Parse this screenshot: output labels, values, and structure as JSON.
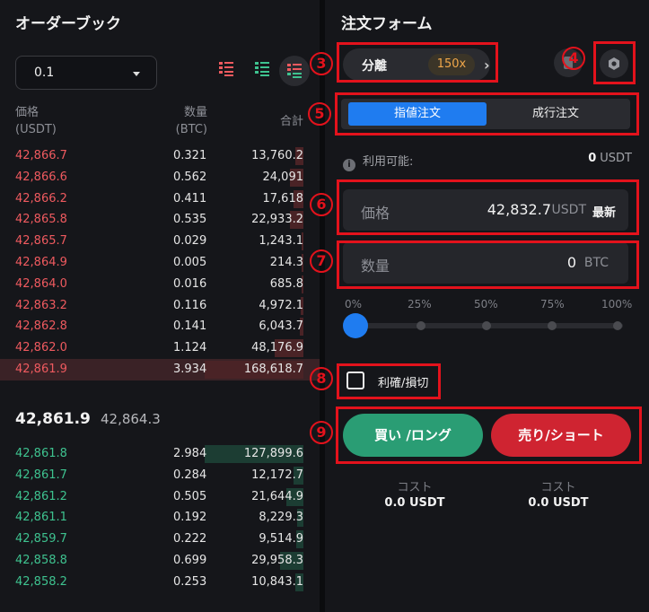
{
  "order_book": {
    "title": "オーダーブック",
    "precision": "0.1",
    "headers": {
      "price": "価格",
      "price_unit": "(USDT)",
      "qty": "数量",
      "qty_unit": "(BTC)",
      "total": "合計"
    },
    "asks": [
      {
        "price": "42,866.7",
        "qty": "0.321",
        "total": "13,760.2",
        "depth": 0.08
      },
      {
        "price": "42,866.6",
        "qty": "0.562",
        "total": "24,091",
        "depth": 0.14
      },
      {
        "price": "42,866.2",
        "qty": "0.411",
        "total": "17,618",
        "depth": 0.1
      },
      {
        "price": "42,865.8",
        "qty": "0.535",
        "total": "22,933.2",
        "depth": 0.14
      },
      {
        "price": "42,865.7",
        "qty": "0.029",
        "total": "1,243.1",
        "depth": 0.01
      },
      {
        "price": "42,864.9",
        "qty": "0.005",
        "total": "214.3",
        "depth": 0.005
      },
      {
        "price": "42,864.0",
        "qty": "0.016",
        "total": "685.8",
        "depth": 0.01
      },
      {
        "price": "42,863.2",
        "qty": "0.116",
        "total": "4,972.1",
        "depth": 0.03
      },
      {
        "price": "42,862.8",
        "qty": "0.141",
        "total": "6,043.7",
        "depth": 0.04
      },
      {
        "price": "42,862.0",
        "qty": "1.124",
        "total": "48,176.9",
        "depth": 0.29
      },
      {
        "price": "42,861.9",
        "qty": "3.934",
        "total": "168,618.7",
        "depth": 1.0
      }
    ],
    "last_price": "42,861.9",
    "mark_price": "42,864.3",
    "bids": [
      {
        "price": "42,861.8",
        "qty": "2.984",
        "total": "127,899.6",
        "depth": 1.0
      },
      {
        "price": "42,861.7",
        "qty": "0.284",
        "total": "12,172.7",
        "depth": 0.1
      },
      {
        "price": "42,861.2",
        "qty": "0.505",
        "total": "21,644.9",
        "depth": 0.17
      },
      {
        "price": "42,861.1",
        "qty": "0.192",
        "total": "8,229.3",
        "depth": 0.06
      },
      {
        "price": "42,859.7",
        "qty": "0.222",
        "total": "9,514.9",
        "depth": 0.07
      },
      {
        "price": "42,858.8",
        "qty": "0.699",
        "total": "29,958.3",
        "depth": 0.24
      },
      {
        "price": "42,858.2",
        "qty": "0.253",
        "total": "10,843.1",
        "depth": 0.08
      }
    ]
  },
  "order_form": {
    "title": "注文フォーム",
    "margin_mode": "分離",
    "leverage": "150x",
    "order_types": [
      "指値注文",
      "成行注文"
    ],
    "available_label": "利用可能:",
    "available_value": "0",
    "available_unit": "USDT",
    "price_label": "価格",
    "price_value": "42,832.7",
    "price_unit": "USDT",
    "price_tag": "最新",
    "qty_label": "数量",
    "qty_value": "0",
    "qty_unit": "BTC",
    "slider_labels": [
      "0%",
      "25%",
      "50%",
      "75%",
      "100%"
    ],
    "slider_value": 0,
    "tpsl_label": "利確/損切",
    "buy_label": "買い /ロング",
    "sell_label": "売り/ショート",
    "cost_label": "コスト",
    "buy_cost": "0.0 USDT",
    "sell_cost": "0.0 USDT"
  },
  "markers": [
    "3",
    "4",
    "5",
    "6",
    "7",
    "8",
    "9"
  ],
  "colors": {
    "ask": "#ef5a5f",
    "bid": "#3ec28f",
    "accent_blue": "#1f7cf0",
    "annotation_red": "#e3121c",
    "leverage_orange": "#f0a74a"
  }
}
